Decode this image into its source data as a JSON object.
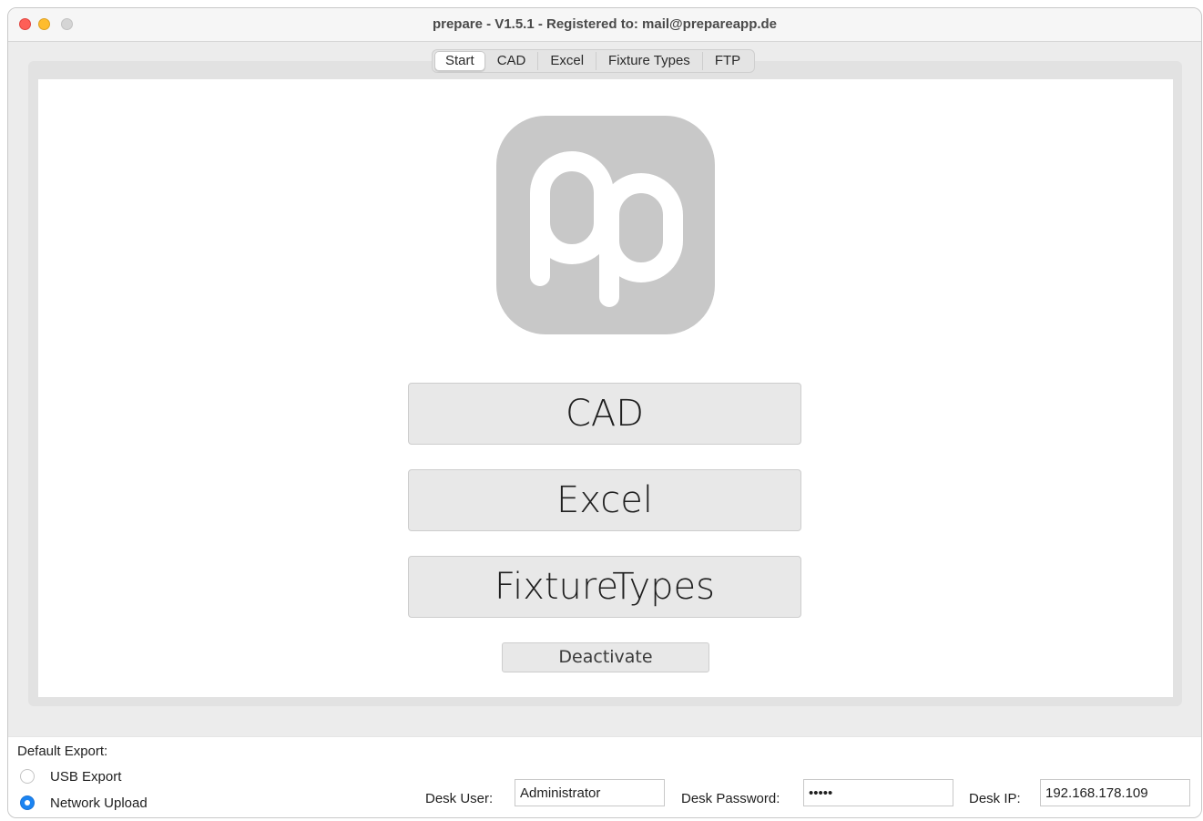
{
  "window": {
    "title": "prepare - V1.5.1 -  Registered to: mail@prepareapp.de"
  },
  "tabs": [
    {
      "label": "Start",
      "active": true
    },
    {
      "label": "CAD"
    },
    {
      "label": "Excel"
    },
    {
      "label": "Fixture Types"
    },
    {
      "label": "FTP"
    }
  ],
  "logo": {
    "letters": "Pp",
    "color": "#c8c8c8"
  },
  "main_buttons": {
    "cad": "CAD",
    "excel": "Excel",
    "fixture_types": "FixtureTypes",
    "deactivate": "Deactivate"
  },
  "footer": {
    "default_export_label": "Default Export:",
    "options": [
      {
        "label": "USB Export",
        "selected": false
      },
      {
        "label": "Network Upload",
        "selected": true
      }
    ],
    "desk_user_label": "Desk User:",
    "desk_user_value": "Administrator",
    "desk_password_label": "Desk Password:",
    "desk_password_value": "•••••",
    "desk_ip_label": "Desk IP:",
    "desk_ip_value": "192.168.178.109"
  },
  "colors": {
    "radio_selected": "#1b84f2",
    "close": "#fe5f57",
    "minimize": "#febc2e"
  }
}
